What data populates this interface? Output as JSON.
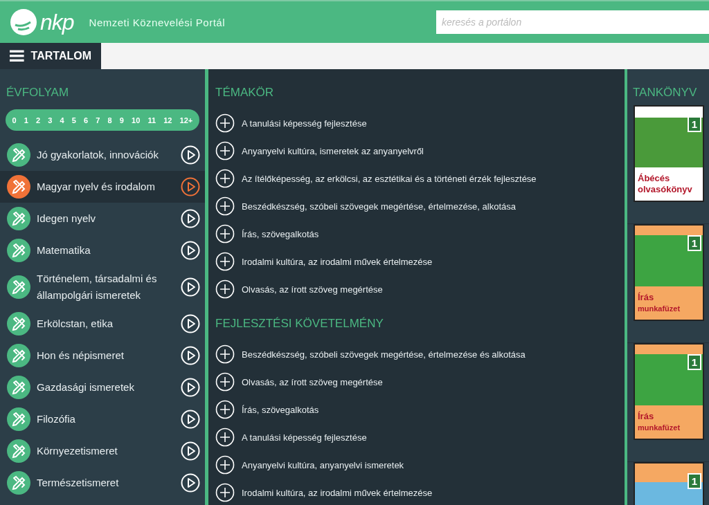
{
  "header": {
    "logo": "nkp",
    "title": "Nemzeti Köznevelési Portál",
    "search": {
      "placeholder": "keresés a portálon"
    }
  },
  "nav": {
    "menu_label": "TARTALOM"
  },
  "grades": {
    "title": "ÉVFOLYAM",
    "items": [
      "0",
      "1",
      "2",
      "3",
      "4",
      "5",
      "6",
      "7",
      "8",
      "9",
      "10",
      "11",
      "12",
      "12+"
    ]
  },
  "subjects": [
    {
      "label": "Jó gyakorlatok, innovációk",
      "selected": false
    },
    {
      "label": "Magyar nyelv és irodalom",
      "selected": true
    },
    {
      "label": "Idegen nyelv",
      "selected": false
    },
    {
      "label": "Matematika",
      "selected": false
    },
    {
      "label": "Történelem, társadalmi és állampolgári ismeretek",
      "selected": false
    },
    {
      "label": "Erkölcstan, etika",
      "selected": false
    },
    {
      "label": "Hon és népismeret",
      "selected": false
    },
    {
      "label": "Gazdasági ismeretek",
      "selected": false
    },
    {
      "label": "Filozófia",
      "selected": false
    },
    {
      "label": "Környezetismeret",
      "selected": false
    },
    {
      "label": "Természetismeret",
      "selected": false
    }
  ],
  "sections": [
    {
      "title": "TÉMAKÖR",
      "items": [
        "A tanulási képesség fejlesztése",
        "Anyanyelvi kultúra, ismeretek az anyanyelvről",
        "Az ítélőképesség, az erkölcsi, az esztétikai és a történeti érzék fejlesztése",
        "Beszédkészség, szóbeli szövegek megértése, értelmezése, alkotása",
        "Írás, szövegalkotás",
        "Irodalmi kultúra, az irodalmi művek értelmezése",
        "Olvasás, az írott szöveg megértése"
      ]
    },
    {
      "title": "FEJLESZTÉSI KÖVETELMÉNY",
      "items": [
        "Beszédkészség, szóbeli szövegek megértése, értelmezése és alkotása",
        "Olvasás, az írott szöveg megértése",
        "Írás, szövegalkotás",
        "A tanulási képesség fejlesztése",
        "Anyanyelvi kultúra, anyanyelvi ismeretek",
        "Irodalmi kultúra, az irodalmi művek értelmezése"
      ]
    }
  ],
  "textbooks": {
    "title": "TANKÖNYV",
    "books": [
      {
        "kind": "reader",
        "grade": "1",
        "title": "Ábécés olvasókönyv"
      },
      {
        "kind": "workbook",
        "grade": "1",
        "title": "Írás",
        "subtitle": "munkafüzet"
      },
      {
        "kind": "workbook",
        "grade": "1",
        "title": "Írás",
        "subtitle": "munkafüzet"
      },
      {
        "kind": "partial",
        "grade": "1"
      }
    ]
  }
}
